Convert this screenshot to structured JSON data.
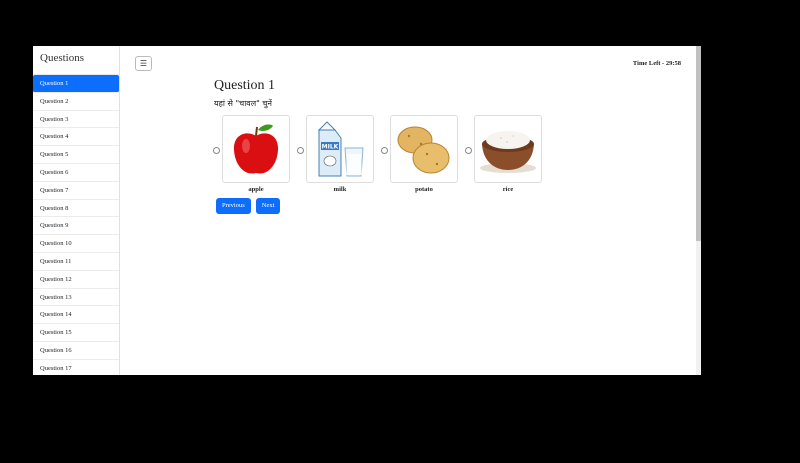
{
  "sidebar": {
    "title": "Questions",
    "items": [
      {
        "label": "Question 1",
        "active": true
      },
      {
        "label": "Question 2"
      },
      {
        "label": "Question 3"
      },
      {
        "label": "Question 4"
      },
      {
        "label": "Question 5"
      },
      {
        "label": "Question 6"
      },
      {
        "label": "Question 7"
      },
      {
        "label": "Question 8"
      },
      {
        "label": "Question 9"
      },
      {
        "label": "Question 10"
      },
      {
        "label": "Question 11"
      },
      {
        "label": "Question 12"
      },
      {
        "label": "Question 13"
      },
      {
        "label": "Question 14"
      },
      {
        "label": "Question 15"
      },
      {
        "label": "Question 16"
      },
      {
        "label": "Question 17"
      }
    ]
  },
  "header": {
    "menu_icon": "☰",
    "timer": "Time Left - 29:58"
  },
  "question": {
    "title": "Question 1",
    "prompt": "यहां से \"चावल\" चुनें",
    "options": [
      {
        "label": "apple",
        "icon": "apple-image"
      },
      {
        "label": "milk",
        "icon": "milk-image"
      },
      {
        "label": "potato",
        "icon": "potato-image"
      },
      {
        "label": "rice",
        "icon": "rice-image"
      }
    ]
  },
  "nav": {
    "previous_label": "Previous",
    "next_label": "Next"
  },
  "colors": {
    "accent": "#0d6efd"
  }
}
